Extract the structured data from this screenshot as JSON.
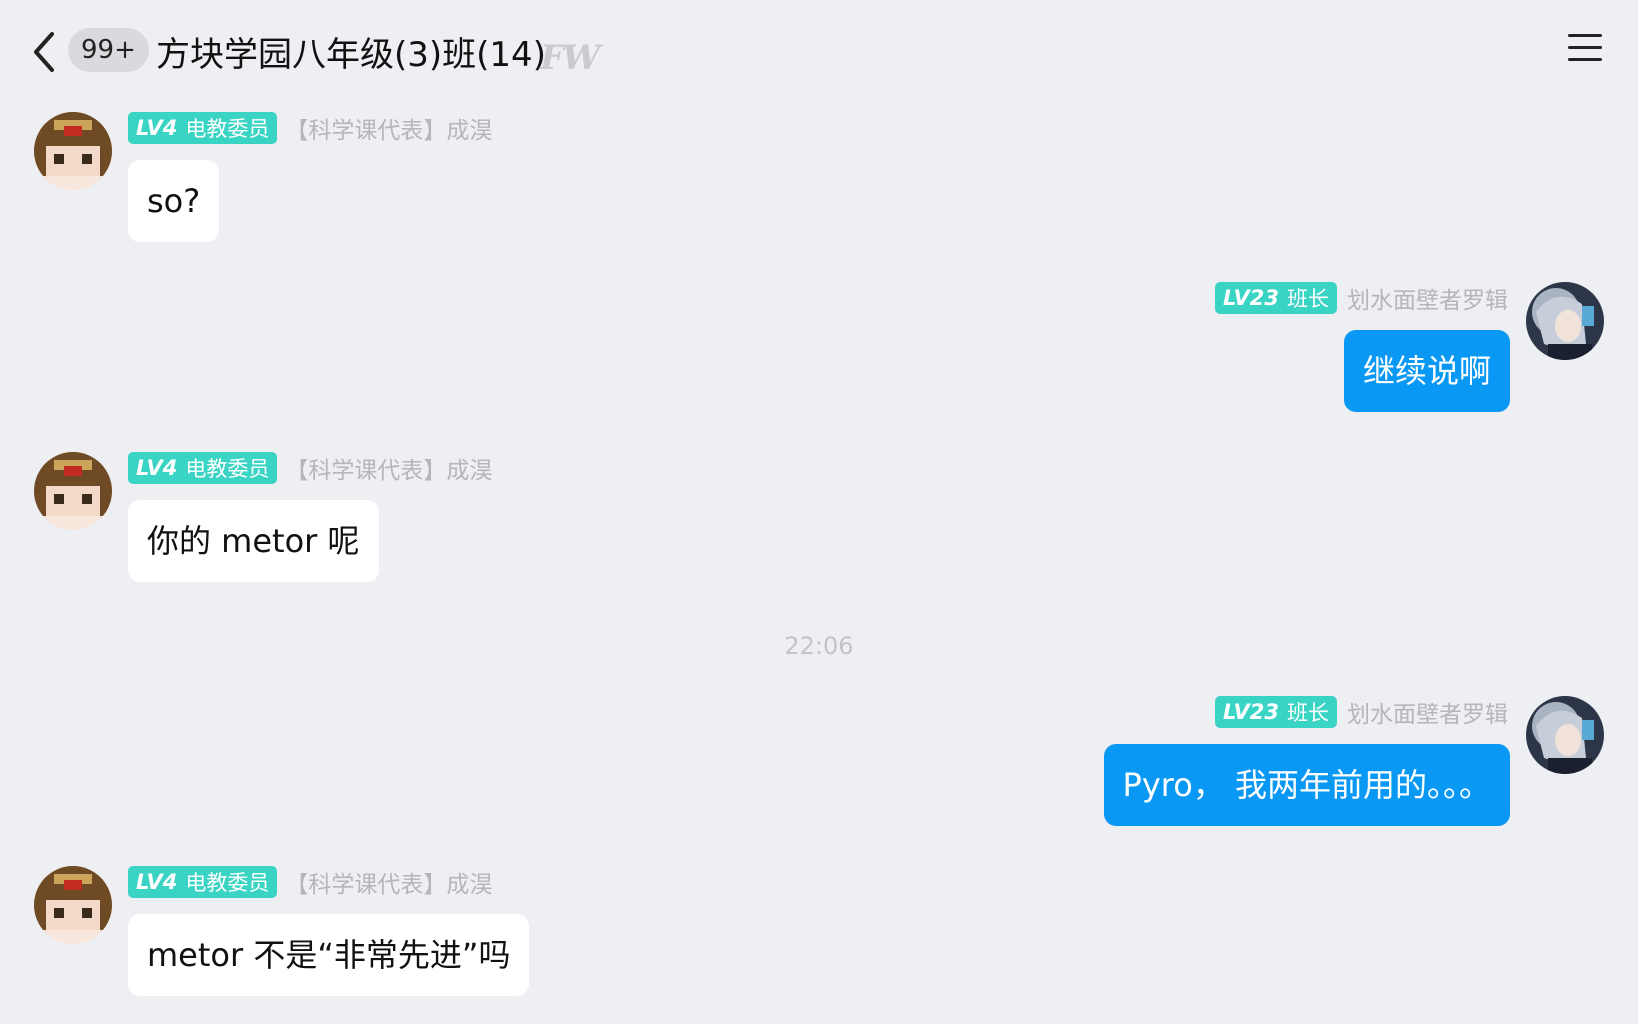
{
  "header": {
    "unread": "99+",
    "title": "方块学园八年级(3)班(14)",
    "tag": "FW"
  },
  "messages": [
    {
      "level": "LV4",
      "role": "电教委员",
      "name": "【科学课代表】成淏",
      "text": "so?"
    },
    {
      "level": "LV23",
      "role": "班长",
      "name": "划水面壁者罗辑",
      "text": "继续说啊"
    },
    {
      "level": "LV4",
      "role": "电教委员",
      "name": "【科学课代表】成淏",
      "text": "你的 metor 呢"
    },
    {
      "timestamp": "22:06"
    },
    {
      "level": "LV23",
      "role": "班长",
      "name": "划水面壁者罗辑",
      "text": "Pyro， 我两年前用的。。。"
    },
    {
      "level": "LV4",
      "role": "电教委员",
      "name": "【科学课代表】成淏",
      "text": "metor 不是“非常先进”吗"
    }
  ],
  "colors": {
    "background": "#eeeff3",
    "out_bubble": "#0a98f5",
    "in_bubble": "#ffffff",
    "level_badge": "#3ad4c4"
  }
}
